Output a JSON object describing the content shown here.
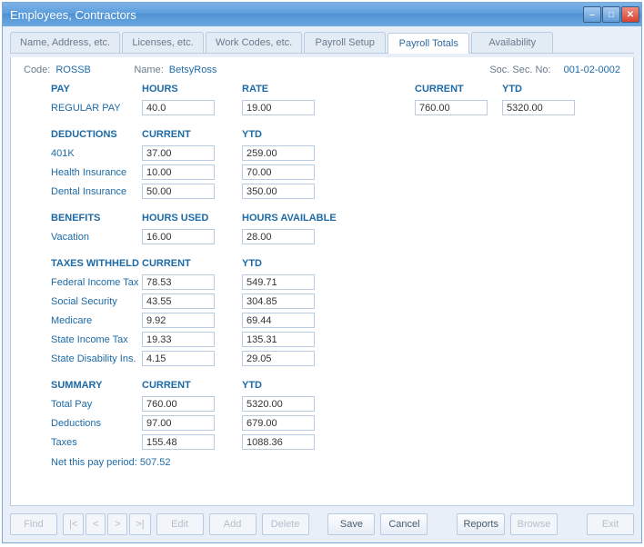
{
  "window": {
    "title": "Employees, Contractors"
  },
  "tabs": [
    "Name, Address, etc.",
    "Licenses, etc.",
    "Work Codes, etc.",
    "Payroll Setup",
    "Payroll Totals",
    "Availability"
  ],
  "active_tab_index": 4,
  "info": {
    "code_label": "Code:",
    "code_value": "ROSSB",
    "name_label": "Name:",
    "name_value": "BetsyRoss",
    "ssn_label": "Soc. Sec. No:",
    "ssn_value": "001-02-0002"
  },
  "pay": {
    "heading": {
      "pay": "PAY",
      "hours": "HOURS",
      "rate": "RATE",
      "current": "CURRENT",
      "ytd": "YTD"
    },
    "rows": [
      {
        "label": "REGULAR PAY",
        "hours": "40.0",
        "rate": "19.00",
        "current": "760.00",
        "ytd": "5320.00"
      }
    ]
  },
  "deductions": {
    "heading": {
      "title": "DEDUCTIONS",
      "c1": "CURRENT",
      "c2": "YTD"
    },
    "rows": [
      {
        "label": "401K",
        "c1": "37.00",
        "c2": "259.00"
      },
      {
        "label": "Health Insurance",
        "c1": "10.00",
        "c2": "70.00"
      },
      {
        "label": "Dental Insurance",
        "c1": "50.00",
        "c2": "350.00"
      }
    ]
  },
  "benefits": {
    "heading": {
      "title": "BENEFITS",
      "c1": "HOURS USED",
      "c2": "HOURS AVAILABLE"
    },
    "rows": [
      {
        "label": "Vacation",
        "c1": "16.00",
        "c2": "28.00"
      }
    ]
  },
  "taxes": {
    "heading": {
      "title": "TAXES WITHHELD",
      "c1": "CURRENT",
      "c2": "YTD"
    },
    "rows": [
      {
        "label": "Federal Income Tax",
        "c1": "78.53",
        "c2": "549.71"
      },
      {
        "label": "Social Security",
        "c1": "43.55",
        "c2": "304.85"
      },
      {
        "label": "Medicare",
        "c1": "9.92",
        "c2": "69.44"
      },
      {
        "label": "State Income Tax",
        "c1": "19.33",
        "c2": "135.31"
      },
      {
        "label": "State Disability Ins.",
        "c1": "4.15",
        "c2": "29.05"
      }
    ]
  },
  "summary": {
    "heading": {
      "title": "SUMMARY",
      "c1": "CURRENT",
      "c2": "YTD"
    },
    "rows": [
      {
        "label": "Total Pay",
        "c1": "760.00",
        "c2": "5320.00"
      },
      {
        "label": "Deductions",
        "c1": "97.00",
        "c2": "679.00"
      },
      {
        "label": "Taxes",
        "c1": "155.48",
        "c2": "1088.36"
      }
    ]
  },
  "net_line": "Net this pay period: 507.52",
  "footer": {
    "find": "Find",
    "nav_first": "|<",
    "nav_prev": "<",
    "nav_next": ">",
    "nav_last": ">|",
    "edit": "Edit",
    "add": "Add",
    "delete": "Delete",
    "save": "Save",
    "cancel": "Cancel",
    "reports": "Reports",
    "browse": "Browse",
    "exit": "Exit"
  }
}
